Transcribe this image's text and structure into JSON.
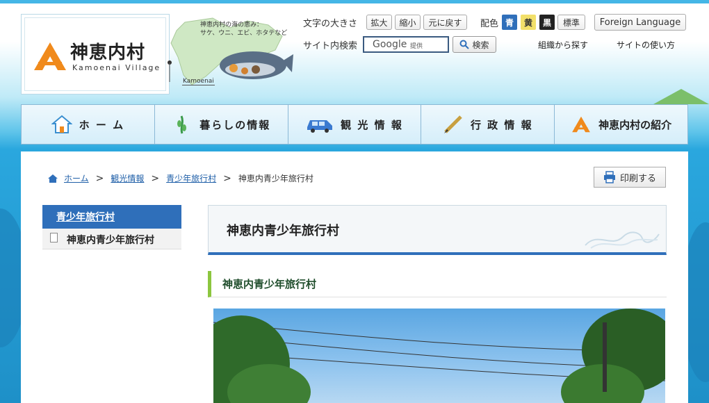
{
  "site": {
    "name": "神恵内村",
    "name_en": "Kamoenai Village",
    "map_caption_line1": "神恵内村の海の恵み：",
    "map_caption_line2": "サケ、ウニ、エビ、ホタテなど",
    "map_label": "Kamoenai"
  },
  "utility": {
    "font_size_label": "文字の大きさ",
    "enlarge": "拡大",
    "shrink": "縮小",
    "reset": "元に戻す",
    "color_label": "配色",
    "color_blue": "青",
    "color_yellow": "黄",
    "color_black": "黒",
    "color_standard": "標準",
    "foreign_language": "Foreign Language",
    "search_label": "サイト内検索",
    "search_google": "Google",
    "search_provided": "提供",
    "search_button": "検索",
    "find_by_org": "組織から探す",
    "how_to_use": "サイトの使い方"
  },
  "nav": [
    {
      "label": "ホ ー ム",
      "icon": "house-icon"
    },
    {
      "label": "暮らしの情報",
      "icon": "plant-icon"
    },
    {
      "label": "観 光 情 報",
      "icon": "car-icon"
    },
    {
      "label": "行 政 情 報",
      "icon": "pen-icon"
    },
    {
      "label": "神恵内村の紹介",
      "icon": "village-logo-icon"
    }
  ],
  "breadcrumb": {
    "home": "ホーム",
    "sightseeing": "観光情報",
    "youth_village": "青少年旅行村",
    "current": "神恵内青少年旅行村"
  },
  "print_label": "印刷する",
  "sidebar": {
    "heading": "青少年旅行村",
    "items": [
      "神恵内青少年旅行村"
    ]
  },
  "main": {
    "page_title": "神恵内青少年旅行村",
    "section_heading": "神恵内青少年旅行村"
  },
  "colors": {
    "accent_blue": "#2f6fba",
    "logo_orange": "#f08a1c",
    "section_green": "#8cc63f"
  }
}
